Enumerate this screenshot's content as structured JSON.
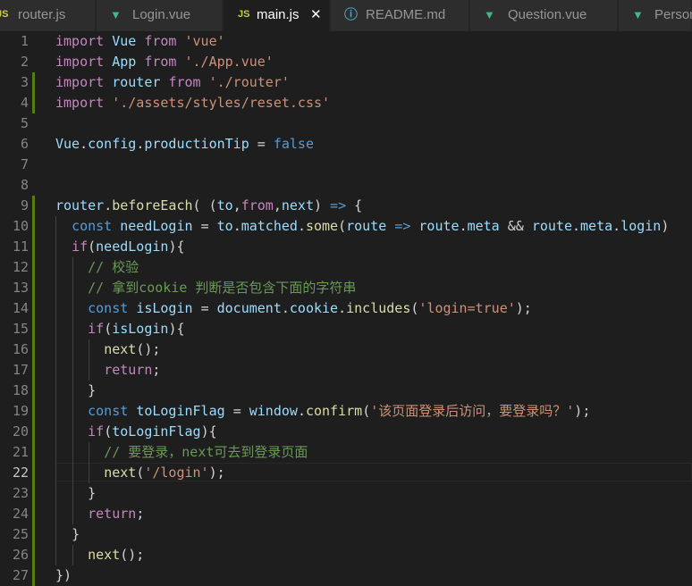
{
  "tabs": [
    {
      "label": "router.js",
      "icon": "js-icon",
      "badge": "JS",
      "active": false
    },
    {
      "label": "Login.vue",
      "icon": "vue-icon",
      "active": false
    },
    {
      "label": "main.js",
      "icon": "js-icon",
      "badge": "JS",
      "active": true
    },
    {
      "label": "README.md",
      "icon": "info-icon",
      "active": false
    },
    {
      "label": "Question.vue",
      "icon": "vue-icon",
      "active": false
    },
    {
      "label": "Person",
      "icon": "vue-icon",
      "active": false
    }
  ],
  "editor": {
    "current_line": 22,
    "lines": [
      {
        "n": "1",
        "code": "import Vue from 'vue'"
      },
      {
        "n": "2",
        "code": "import App from './App.vue'"
      },
      {
        "n": "3",
        "code": "import router from './router'"
      },
      {
        "n": "4",
        "code": "import './assets/styles/reset.css'"
      },
      {
        "n": "5",
        "code": ""
      },
      {
        "n": "6",
        "code": "Vue.config.productionTip = false"
      },
      {
        "n": "7",
        "code": ""
      },
      {
        "n": "8",
        "code": ""
      },
      {
        "n": "9",
        "code": "router.beforeEach( (to,from,next) => {"
      },
      {
        "n": "10",
        "code": "  const needLogin = to.matched.some(route => route.meta && route.meta.login)"
      },
      {
        "n": "11",
        "code": "  if(needLogin){"
      },
      {
        "n": "12",
        "code": "    // 校验"
      },
      {
        "n": "13",
        "code": "    // 拿到cookie 判断是否包含下面的字符串"
      },
      {
        "n": "14",
        "code": "    const isLogin = document.cookie.includes('login=true');"
      },
      {
        "n": "15",
        "code": "    if(isLogin){"
      },
      {
        "n": "16",
        "code": "      next();"
      },
      {
        "n": "17",
        "code": "      return;"
      },
      {
        "n": "18",
        "code": "    }"
      },
      {
        "n": "19",
        "code": "    const toLoginFlag = window.confirm('该页面登录后访问，要登录吗？');"
      },
      {
        "n": "20",
        "code": "    if(toLoginFlag){"
      },
      {
        "n": "21",
        "code": "      // 要登录，next可去到登录页面"
      },
      {
        "n": "22",
        "code": "      next('/login');"
      },
      {
        "n": "23",
        "code": "    }"
      },
      {
        "n": "24",
        "code": "    return;"
      },
      {
        "n": "25",
        "code": "  }"
      },
      {
        "n": "26",
        "code": "    next();"
      },
      {
        "n": "27",
        "code": "})"
      }
    ]
  },
  "colors": {
    "background": "#1e1e1e",
    "keyword": "#569cd6",
    "control": "#c586c0",
    "string": "#ce9178",
    "function": "#dcdcaa",
    "variable": "#9cdcfe",
    "comment": "#6a9955",
    "git_modified": "#587c0c"
  }
}
